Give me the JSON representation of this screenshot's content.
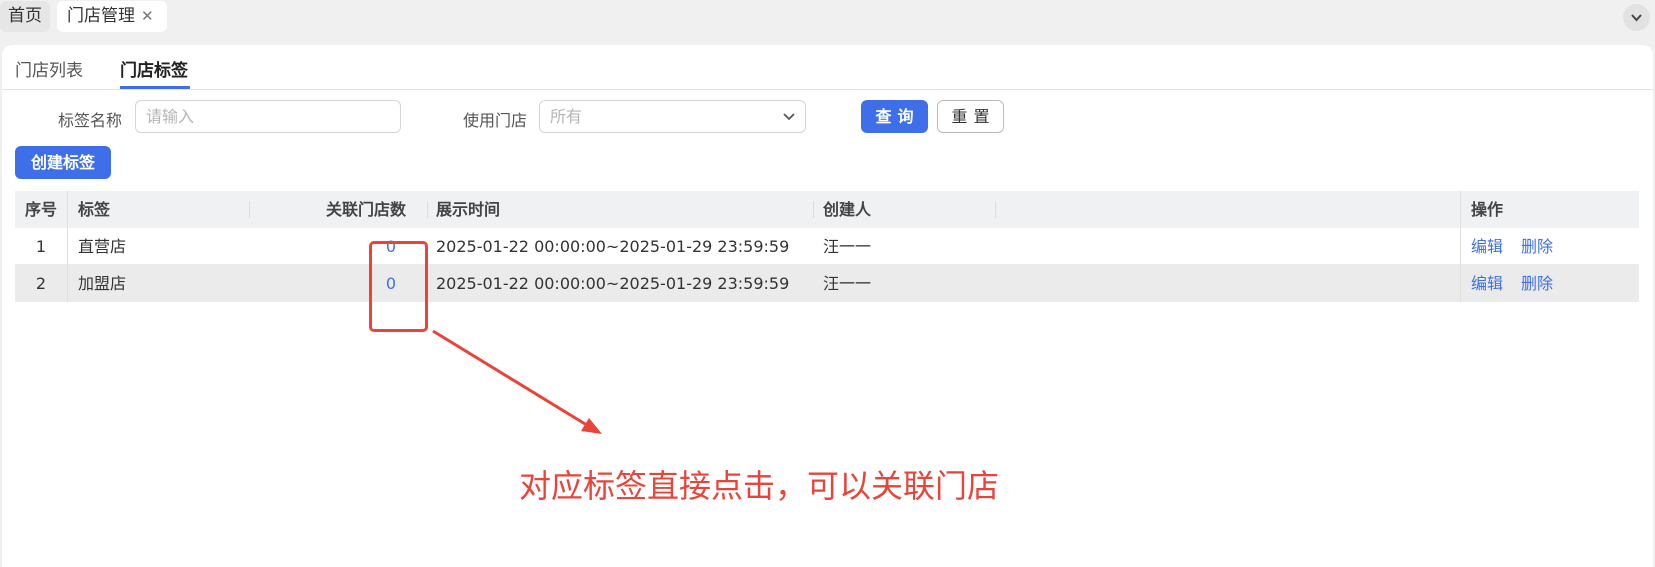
{
  "page_tabs": [
    {
      "label": "首页"
    },
    {
      "label": "门店管理",
      "close": "✕"
    }
  ],
  "collapse_icon": "⌄",
  "sub_tabs": [
    {
      "label": "门店列表"
    },
    {
      "label": "门店标签"
    }
  ],
  "filters": {
    "tag_name_label": "标签名称",
    "tag_name_placeholder": "请输入",
    "use_store_label": "使用门店",
    "use_store_value": "所有",
    "chevron": "⌄"
  },
  "buttons": {
    "query": "查询",
    "reset": "重置",
    "create": "创建标签"
  },
  "table": {
    "headers": {
      "index": "序号",
      "tag": "标签",
      "store_count": "关联门店数",
      "display_time": "展示时间",
      "creator": "创建人",
      "ops": "操作"
    },
    "rows": [
      {
        "index": "1",
        "tag": "直营店",
        "store_count": "0",
        "display_time": "2025-01-22 00:00:00~2025-01-29 23:59:59",
        "creator": "汪一一",
        "edit": "编辑",
        "delete": "删除"
      },
      {
        "index": "2",
        "tag": "加盟店",
        "store_count": "0",
        "display_time": "2025-01-22 00:00:00~2025-01-29 23:59:59",
        "creator": "汪一一",
        "edit": "编辑",
        "delete": "删除"
      }
    ]
  },
  "annotation": {
    "text": "对应标签直接点击，可以关联门店",
    "color": "#e8443a"
  },
  "colors": {
    "accent": "#3f6fe8"
  }
}
